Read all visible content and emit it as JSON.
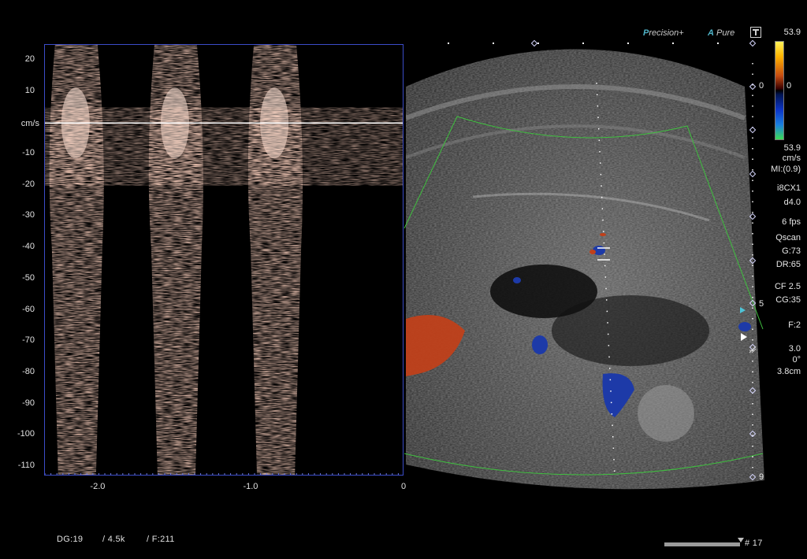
{
  "brand": {
    "precision": "Precision+",
    "apure": "APure"
  },
  "color_scale": {
    "top_value": "53.9",
    "zero_label": "0",
    "bottom_value": "53.9",
    "unit": "cm/s"
  },
  "parameters": [
    "MI:(0.9)",
    "i8CX1",
    "d4.0",
    "6 fps",
    "Qscan",
    "G:73",
    "DR:65",
    "CF 2.5",
    "CG:35",
    "F:2",
    "3.0",
    "0°",
    "3.8cm"
  ],
  "depth_labels": [
    "0",
    "5",
    "9"
  ],
  "doppler": {
    "unit": "cm/s",
    "y_ticks": [
      "20",
      "10",
      "-10",
      "-20",
      "-30",
      "-40",
      "-50",
      "-60",
      "-70",
      "-80",
      "-90",
      "-100",
      "-110"
    ],
    "x_ticks": [
      "-2.0",
      "-1.0",
      "0"
    ],
    "baseline_value": 0,
    "y_range": [
      25,
      -113
    ],
    "x_range": [
      -2.35,
      0
    ]
  },
  "bottom_bar": {
    "dg": "DG:19",
    "prf": "/ 4.5k",
    "frame": "/ F:211",
    "clip_index": "# 17",
    "clip_progress": 1.0
  },
  "colors": {
    "doppler_border": "#3b4cc8",
    "sector_outline": "#3fbf3f",
    "spectrum": "#f0b8a0",
    "flow_red": "#c0401a",
    "flow_blue": "#1d3aa8"
  }
}
